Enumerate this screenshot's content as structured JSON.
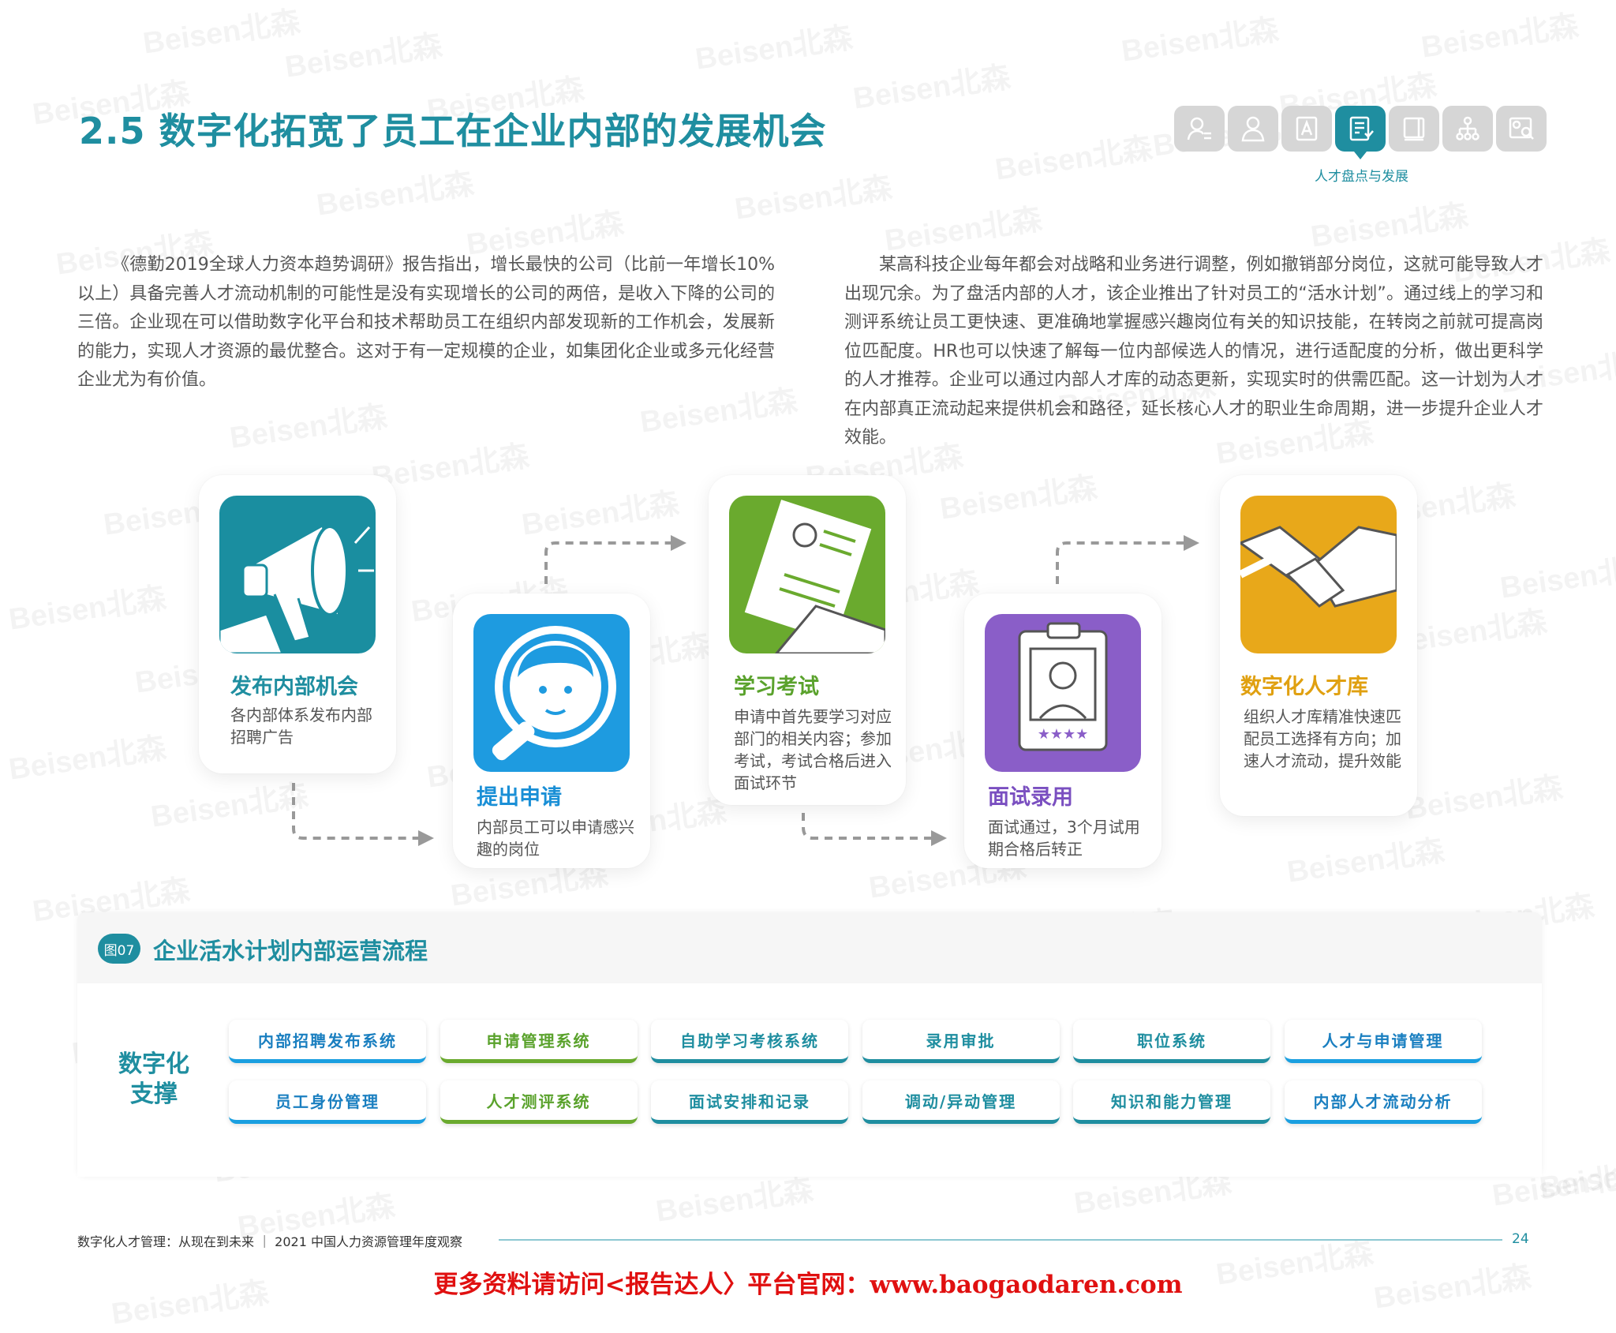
{
  "watermark": "Beisen北森",
  "title": "2.5 数字化拓宽了员工在企业内部的发展机会",
  "nav": {
    "icons": [
      "person-icon",
      "group-icon",
      "document-a-icon",
      "review-icon",
      "book-icon",
      "org-chart-icon",
      "profile-search-icon"
    ],
    "active_caption": "人才盘点与发展"
  },
  "paragraphs": {
    "left": "《德勤2019全球人力资本趋势调研》报告指出，增长最快的公司（比前一年增长10% 以上）具备完善人才流动机制的可能性是没有实现增长的公司的两倍，是收入下降的公司的三倍。企业现在可以借助数字化平台和技术帮助员工在组织内部发现新的工作机会，发展新的能力，实现人才资源的最优整合。这对于有一定规模的企业，如集团化企业或多元化经营企业尤为有价值。",
    "right": "某高科技企业每年都会对战略和业务进行调整，例如撤销部分岗位，这就可能导致人才出现冗余。为了盘活内部的人才，该企业推出了针对员工的“活水计划”。通过线上的学习和测评系统让员工更快速、更准确地掌握感兴趣岗位有关的知识技能，在转岗之前就可提高岗位匹配度。HR也可以快速了解每一位内部候选人的情况，进行适配度的分析，做出更科学的人才推荐。企业可以通过内部人才库的动态更新，实现实时的供需匹配。这一计划为人才在内部真正流动起来提供机会和路径，延长核心人才的职业生命周期，进一步提升企业人才效能。"
  },
  "steps": [
    {
      "title": "发布内部机会",
      "desc": "各内部体系发布内部招聘广告",
      "color": "#1a8ea0",
      "title_color": "#1f8ea0"
    },
    {
      "title": "提出申请",
      "desc": "内部员工可以申请感兴趣的岗位",
      "color": "#1e9be0",
      "title_color": "#1a8fd6"
    },
    {
      "title": "学习考试",
      "desc": "申请中首先要学习对应部门的相关内容；参加考试，考试合格后进入面试环节",
      "color": "#6aaa2e",
      "title_color": "#5aa22c"
    },
    {
      "title": "面试录用",
      "desc": "面试通过，3个月试用期合格后转正",
      "color": "#8a5ec8",
      "title_color": "#7a4fc0"
    },
    {
      "title": "数字化人才库",
      "desc": "组织人才库精准快速匹配员工选择有方向；加速人才流动，提升效能",
      "color": "#e8a81a",
      "title_color": "#e0a010"
    }
  ],
  "figure": {
    "badge": "图07",
    "title": "企业活水计划内部运营流程",
    "support_label": "数字化支撑",
    "systems": [
      {
        "label": "内部招聘发布系统",
        "tone": "blue"
      },
      {
        "label": "申请管理系统",
        "tone": "green"
      },
      {
        "label": "自助学习考核系统",
        "tone": "teal"
      },
      {
        "label": "录用审批",
        "tone": "teal"
      },
      {
        "label": "职位系统",
        "tone": "teal"
      },
      {
        "label": "人才与申请管理",
        "tone": "blue"
      },
      {
        "label": "员工身份管理",
        "tone": "blue"
      },
      {
        "label": "人才测评系统",
        "tone": "green"
      },
      {
        "label": "面试安排和记录",
        "tone": "teal"
      },
      {
        "label": "调动/异动管理",
        "tone": "teal"
      },
      {
        "label": "知识和能力管理",
        "tone": "teal"
      },
      {
        "label": "内部人才流动分析",
        "tone": "blue"
      }
    ]
  },
  "footer": {
    "text": "数字化人才管理：从现在到未来 ｜ 2021 中国人力资源管理年度观察",
    "page": "24"
  },
  "promo": "更多资料请访问<报告达人〉平台官网：www.baogaodaren.com"
}
